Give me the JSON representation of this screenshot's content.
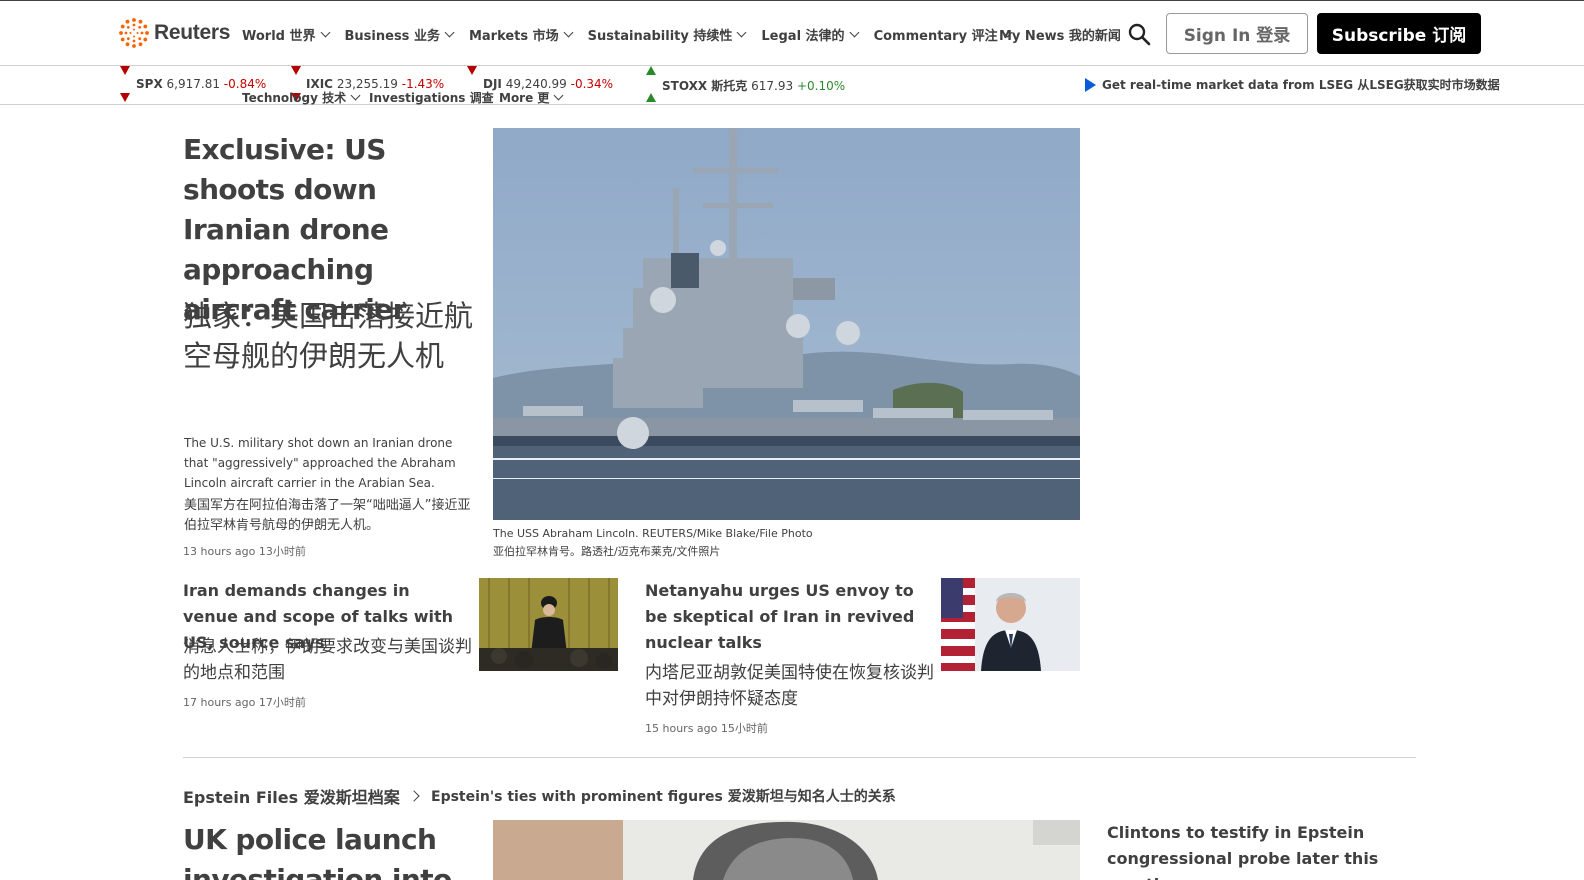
{
  "brand": {
    "name": "Reuters",
    "accent": "#fa6400"
  },
  "nav": {
    "items": [
      {
        "label": "World 世界"
      },
      {
        "label": "Business 业务"
      },
      {
        "label": "Markets 市场"
      },
      {
        "label": "Sustainability 持续性"
      },
      {
        "label": "Legal 法律的"
      },
      {
        "label": "Commentary 评注"
      }
    ],
    "my_news": "My News 我的新闻",
    "sign_in": "Sign In 登录",
    "subscribe": "Subscribe 订阅"
  },
  "subnav": [
    {
      "label": "Technology 技术"
    },
    {
      "label": "Investigations 调查"
    },
    {
      "label": "More 更"
    }
  ],
  "ticker": [
    {
      "symbol": "SPX",
      "value": "6,917.81",
      "change": "-0.84%",
      "direction": "down"
    },
    {
      "symbol": "IXIC",
      "value": "23,255.19",
      "change": "-1.43%",
      "direction": "down"
    },
    {
      "symbol": "DJI",
      "value": "49,240.99",
      "change": "-0.34%",
      "direction": "down"
    },
    {
      "symbol": "STOXX 斯托克",
      "value": "617.93",
      "change": "+0.10%",
      "direction": "up"
    }
  ],
  "lseg_link": "Get real-time market data from LSEG 从LSEG获取实时市场数据",
  "hero": {
    "title": "Exclusive: US shoots down Iranian drone approaching aircraft carrier",
    "title_zh": "独家：美国击落接近航空母舰的伊朗无人机",
    "description": "The U.S. military shot down an Iranian drone that \"aggressively\" approached the Abraham Lincoln aircraft carrier in the Arabian Sea.",
    "description_zh": "美国军方在阿拉伯海击落了一架“咄咄逼人”接近亚伯拉罕林肯号航母的伊朗无人机。",
    "time": "13 hours ago 13小时前",
    "caption": "The USS Abraham Lincoln. REUTERS/Mike Blake/File Photo",
    "caption_zh": "亚伯拉罕林肯号。路透社/迈克布莱克/文件照片"
  },
  "stories": [
    {
      "title": "Iran demands changes in venue and scope of talks with US, source says",
      "title_zh": "消息人士称，伊朗要求改变与美国谈判的地点和范围",
      "time": "17 hours ago 17小时前"
    },
    {
      "title": "Netanyahu urges US envoy to be skeptical of Iran in revived nuclear talks",
      "title_zh": "内塔尼亚胡敦促美国特使在恢复核谈判中对伊朗持怀疑态度",
      "time": "15 hours ago 15小时前"
    }
  ],
  "section": {
    "title": "Epstein Files 爱泼斯坦档案",
    "subtitle": "Epstein's ties with prominent figures 爱泼斯坦与知名人士的关系",
    "lead_title": "UK police launch investigation into",
    "side_title": "Clintons to testify in Epstein congressional probe later this month"
  }
}
